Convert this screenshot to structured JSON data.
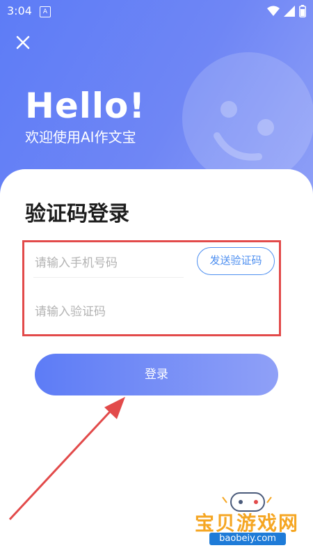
{
  "status_bar": {
    "time": "3:04",
    "notification_letter": "A"
  },
  "header": {
    "greeting": "Hello!",
    "subtitle": "欢迎使用AI作文宝"
  },
  "login": {
    "title": "验证码登录",
    "phone_placeholder": "请输入手机号码",
    "code_placeholder": "请输入验证码",
    "send_code_label": "发送验证码",
    "submit_label": "登录"
  },
  "watermark": {
    "name": "宝贝游戏网",
    "url": "baobeiy.com"
  },
  "colors": {
    "accent": "#5d7cf6",
    "link": "#4c8ef0",
    "annotation": "#e24a4a"
  },
  "icons": [
    "close-icon",
    "wifi-icon",
    "signal-icon",
    "battery-icon",
    "smiley-icon",
    "gamepad-icon"
  ]
}
